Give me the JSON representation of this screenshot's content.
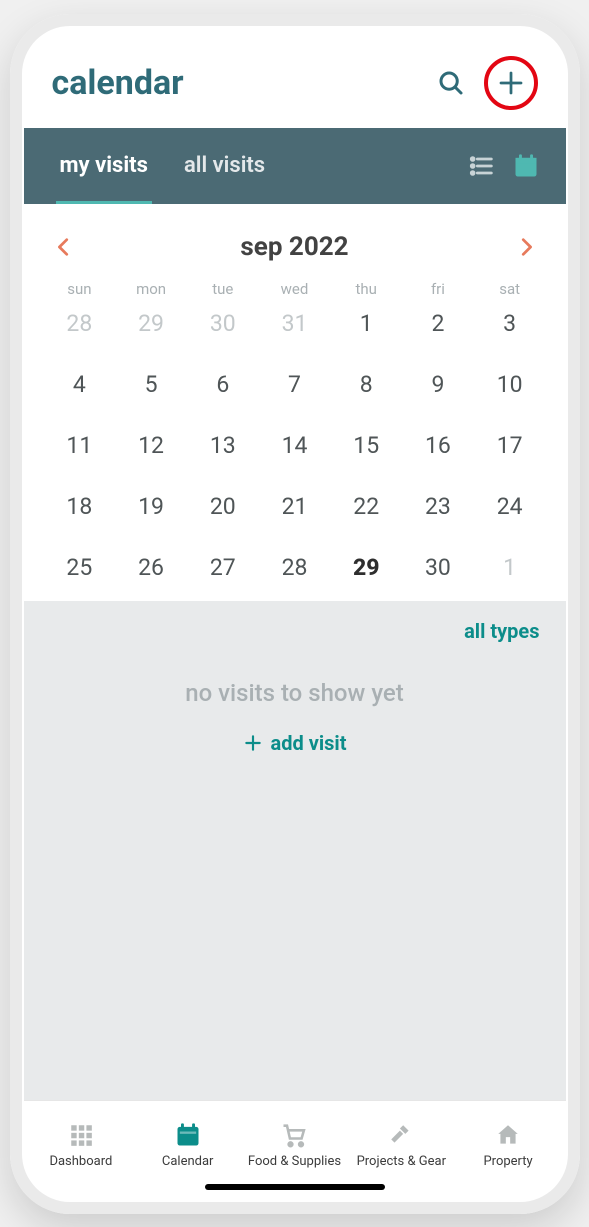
{
  "header": {
    "title": "calendar"
  },
  "tabs": {
    "my_visits": "my visits",
    "all_visits": "all visits"
  },
  "month": {
    "label": "sep 2022"
  },
  "weekdays": [
    "sun",
    "mon",
    "tue",
    "wed",
    "thu",
    "fri",
    "sat"
  ],
  "days": [
    {
      "n": "28",
      "muted": true
    },
    {
      "n": "29",
      "muted": true
    },
    {
      "n": "30",
      "muted": true
    },
    {
      "n": "31",
      "muted": true
    },
    {
      "n": "1"
    },
    {
      "n": "2"
    },
    {
      "n": "3"
    },
    {
      "n": "4"
    },
    {
      "n": "5"
    },
    {
      "n": "6"
    },
    {
      "n": "7"
    },
    {
      "n": "8"
    },
    {
      "n": "9"
    },
    {
      "n": "10"
    },
    {
      "n": "11"
    },
    {
      "n": "12"
    },
    {
      "n": "13"
    },
    {
      "n": "14"
    },
    {
      "n": "15"
    },
    {
      "n": "16"
    },
    {
      "n": "17"
    },
    {
      "n": "18"
    },
    {
      "n": "19"
    },
    {
      "n": "20"
    },
    {
      "n": "21"
    },
    {
      "n": "22"
    },
    {
      "n": "23"
    },
    {
      "n": "24"
    },
    {
      "n": "25"
    },
    {
      "n": "26"
    },
    {
      "n": "27"
    },
    {
      "n": "28"
    },
    {
      "n": "29",
      "today": true
    },
    {
      "n": "30"
    },
    {
      "n": "1",
      "muted": true
    }
  ],
  "filter": {
    "label": "all types"
  },
  "empty": {
    "message": "no visits to show yet",
    "add_label": "add visit"
  },
  "bottom_nav": {
    "items": [
      {
        "label": "Dashboard"
      },
      {
        "label": "Calendar"
      },
      {
        "label": "Food & Supplies"
      },
      {
        "label": "Projects & Gear"
      },
      {
        "label": "Property"
      }
    ]
  }
}
